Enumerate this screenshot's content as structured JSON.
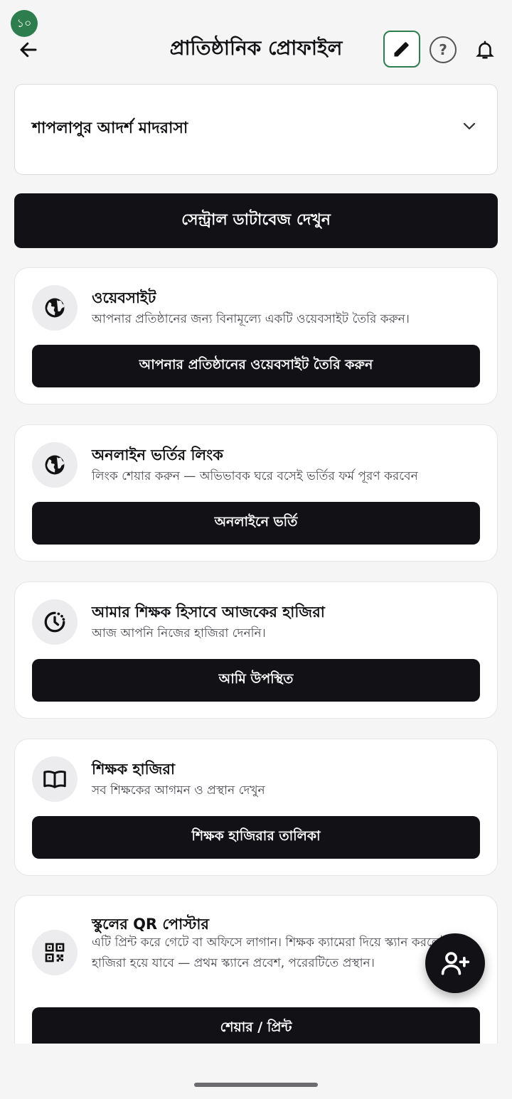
{
  "status_badge": "১০",
  "header": {
    "title": "প্রাতিষ্ঠানিক প্রোফাইল"
  },
  "institution_dropdown": {
    "selected": "শাপলাপুর আদর্শ মাদরাসা"
  },
  "central_db_button": "সেন্ট্রাল ডাটাবেজ দেখুন",
  "cards": [
    {
      "icon": "globe-icon",
      "title": "ওয়েবসাইট",
      "desc": "আপনার প্রতিষ্ঠানের জন্য বিনামূল্যে একটি ওয়েবসাইট তৈরি করুন।",
      "button": "আপনার প্রতিষ্ঠানের ওয়েবসাইট তৈরি করুন"
    },
    {
      "icon": "globe-icon",
      "title": "অনলাইন ভর্তির লিংক",
      "desc": "লিংক শেয়ার করুন — অভিভাবক ঘরে বসেই ভর্তির ফর্ম পূরণ করবেন",
      "button": "অনলাইনে ভর্তি"
    },
    {
      "icon": "clock-icon",
      "title": "আমার শিক্ষক হিসাবে আজকের হাজিরা",
      "desc": "আজ আপনি নিজের হাজিরা দেননি।",
      "button": "আমি উপস্থিত"
    },
    {
      "icon": "book-icon",
      "title": "শিক্ষক হাজিরা",
      "desc": "সব শিক্ষকের আগমন ও প্রস্থান দেখুন",
      "button": "শিক্ষক হাজিরার তালিকা"
    },
    {
      "icon": "qr-code-icon",
      "title": "স্কুলের QR পোস্টার",
      "desc": "এটি প্রিন্ট করে গেটে বা অফিসে লাগান। শিক্ষক ক্যামেরা দিয়ে স্ক্যান করলেই তাঁর হাজিরা হয়ে যাবে — প্রথম স্ক্যানে প্রবেশ, পরেরটিতে প্রস্থান।",
      "button": "শেয়ার / প্রিন্ট"
    }
  ],
  "colors": {
    "accent_green": "#2e7d4f",
    "button_dark": "#111116",
    "background": "#f5f5f6"
  }
}
